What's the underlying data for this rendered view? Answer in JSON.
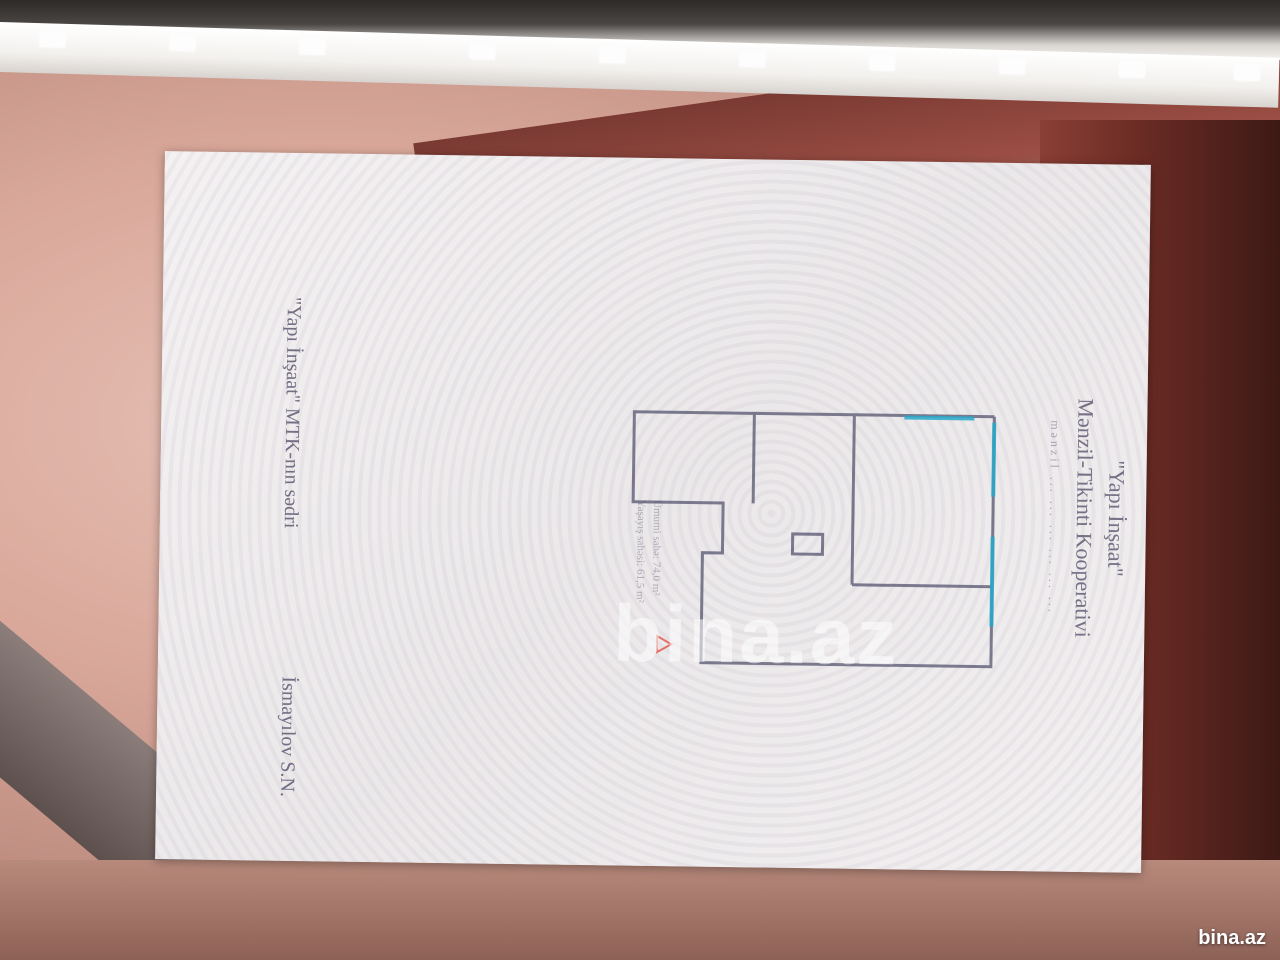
{
  "document": {
    "header_quote": "\"Yapı İnşaat\"",
    "header_org": "Mənzil-Tikinti Kooperativi",
    "header_detail": "mənzil ... ... ... ... ... ...",
    "area_line_1": "Ümumi sahə: 74,0 m²",
    "area_line_2": "Yaşayış sahəsi: 61,5 m²",
    "signature_title_line1": "\"Yapı İnşaat\" MTK-nın sədri",
    "signature_name": "İsmayılov S.N."
  },
  "watermark": {
    "text": "bina.az"
  },
  "corner_logo": {
    "text": "bina.az"
  },
  "colors": {
    "paper": "#eeebed",
    "ink": "#55506a",
    "plan_walls": "#4a4a66",
    "plan_windows": "#2aa8c9",
    "plan_marker": "#e0605a"
  }
}
